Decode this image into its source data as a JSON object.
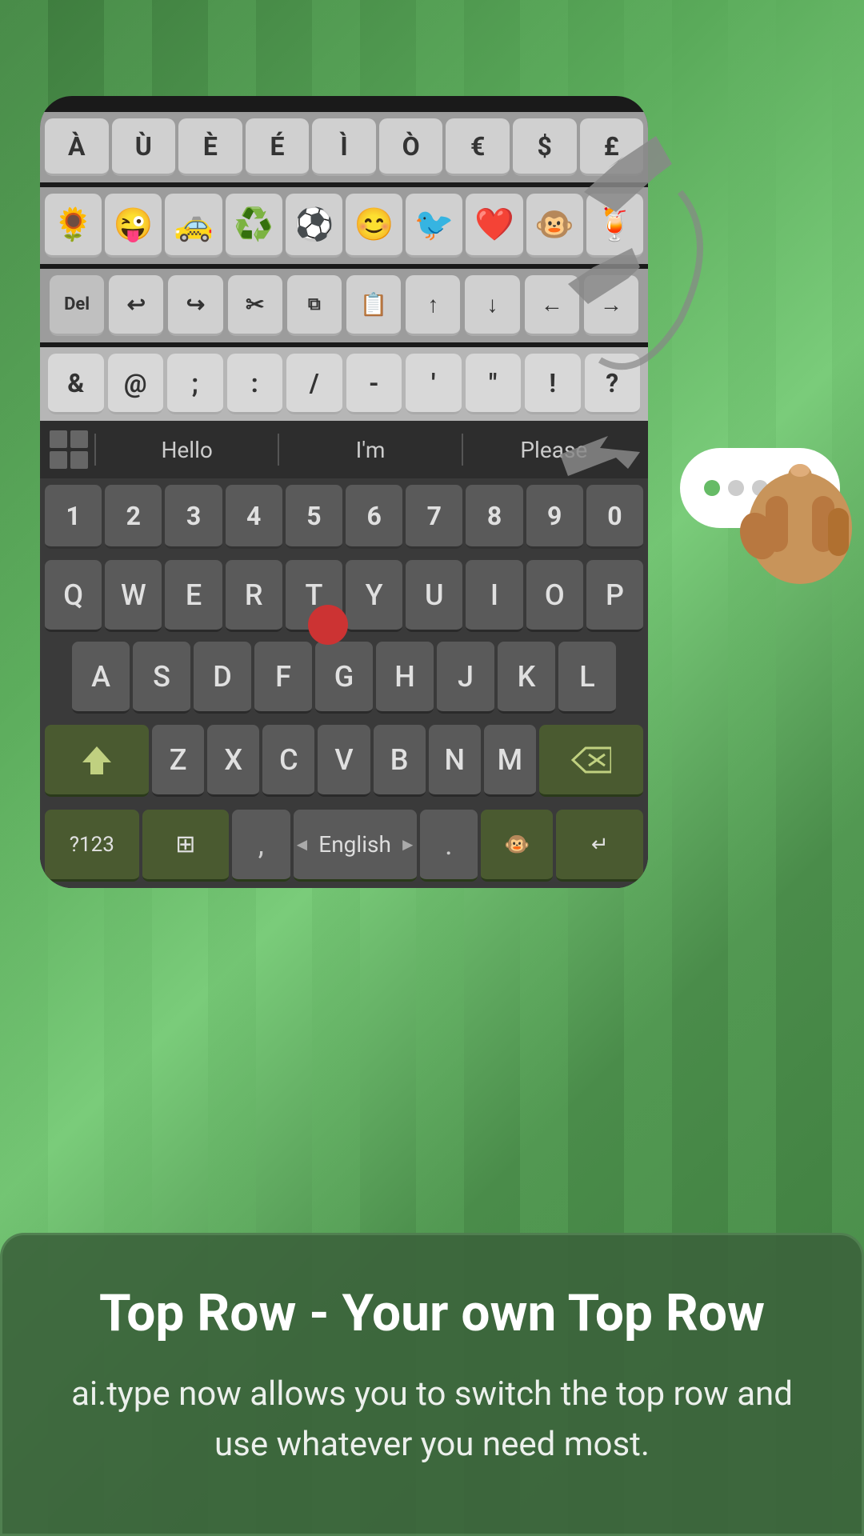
{
  "background": {
    "color": "#4a8c4a"
  },
  "keyboard": {
    "special_chars": [
      "À",
      "Ù",
      "È",
      "É",
      "Ì",
      "Ò",
      "€",
      "$",
      "£"
    ],
    "emojis": [
      "🌻",
      "😜",
      "🚕",
      "♻️",
      "⚽",
      "😊",
      "🐦",
      "❤️",
      "🐵",
      "🍹"
    ],
    "edit_keys": [
      "Del",
      "↩",
      "↪",
      "✂",
      "⧉",
      "📋",
      "↑",
      "↓",
      "←",
      "→"
    ],
    "symbols": [
      "&",
      "@",
      ";",
      ":",
      "/",
      "-",
      "'",
      "\"",
      "!",
      "?"
    ],
    "suggestions": [
      "Hello",
      "I'm",
      "Please"
    ],
    "numbers": [
      "1",
      "2",
      "3",
      "4",
      "5",
      "6",
      "7",
      "8",
      "9",
      "0"
    ],
    "row1": [
      "Q",
      "W",
      "E",
      "R",
      "T",
      "Y",
      "U",
      "I",
      "O",
      "P"
    ],
    "row2": [
      "A",
      "S",
      "D",
      "F",
      "G",
      "H",
      "J",
      "K",
      "L"
    ],
    "row3": [
      "Z",
      "X",
      "C",
      "V",
      "B",
      "N",
      "M"
    ],
    "bottom": {
      "num_switch": "?123",
      "layout_switch": "⊞",
      "comma": ",",
      "language": "English",
      "lang_arrows": "◄ ►",
      "period": ".",
      "emoji": "🐵",
      "enter": "↵"
    },
    "progress_dots": {
      "active_color": "#66bb66",
      "inactive_color": "#cccccc",
      "count": 5,
      "active_index": 0
    }
  },
  "info_panel": {
    "title": "Top Row - Your own Top Row",
    "description": "ai.type now allows you to switch the top row and use whatever you need most."
  }
}
